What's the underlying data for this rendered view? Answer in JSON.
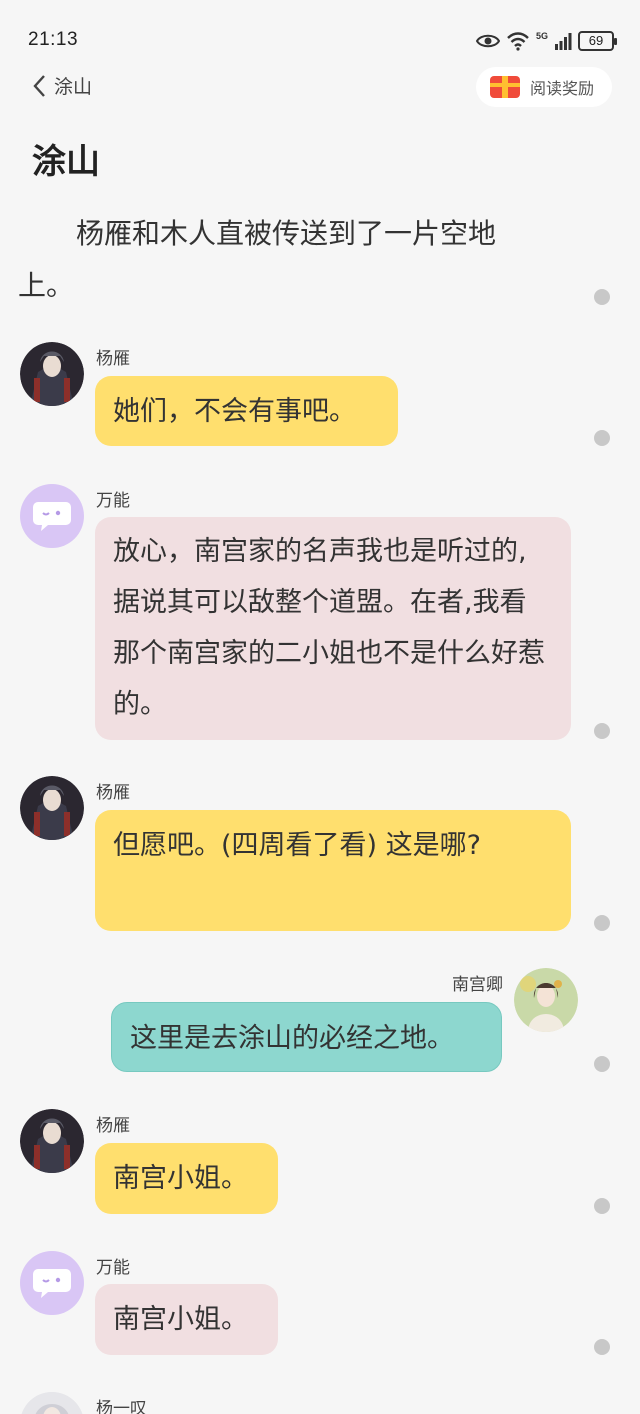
{
  "status": {
    "time": "21:13",
    "network": "5G",
    "battery": "69"
  },
  "nav": {
    "back_label": "涂山",
    "reward_label": "阅读奖励"
  },
  "chapter_title": "涂山",
  "narration": "杨雁和木人直被传送到了一片空地上。",
  "messages": [
    {
      "speaker": "杨雁",
      "text": "她们，不会有事吧。",
      "side": "left",
      "style": "yellow"
    },
    {
      "speaker": "万能",
      "text": "放心，南宫家的名声我也是听过的,据说其可以敌整个道盟。在者,我看那个南宫家的二小姐也不是什么好惹的。",
      "side": "left",
      "style": "pink"
    },
    {
      "speaker": "杨雁",
      "text": "但愿吧。(四周看了看) 这是哪?",
      "side": "left",
      "style": "yellow"
    },
    {
      "speaker": "南宫卿",
      "text": "这里是去涂山的必经之地。",
      "side": "right",
      "style": "teal"
    },
    {
      "speaker": "杨雁",
      "text": "南宫小姐。",
      "side": "left",
      "style": "yellow"
    },
    {
      "speaker": "万能",
      "text": "南宫小姐。",
      "side": "left",
      "style": "pink"
    },
    {
      "speaker": "杨一叹",
      "text": "",
      "side": "left",
      "style": ""
    }
  ]
}
